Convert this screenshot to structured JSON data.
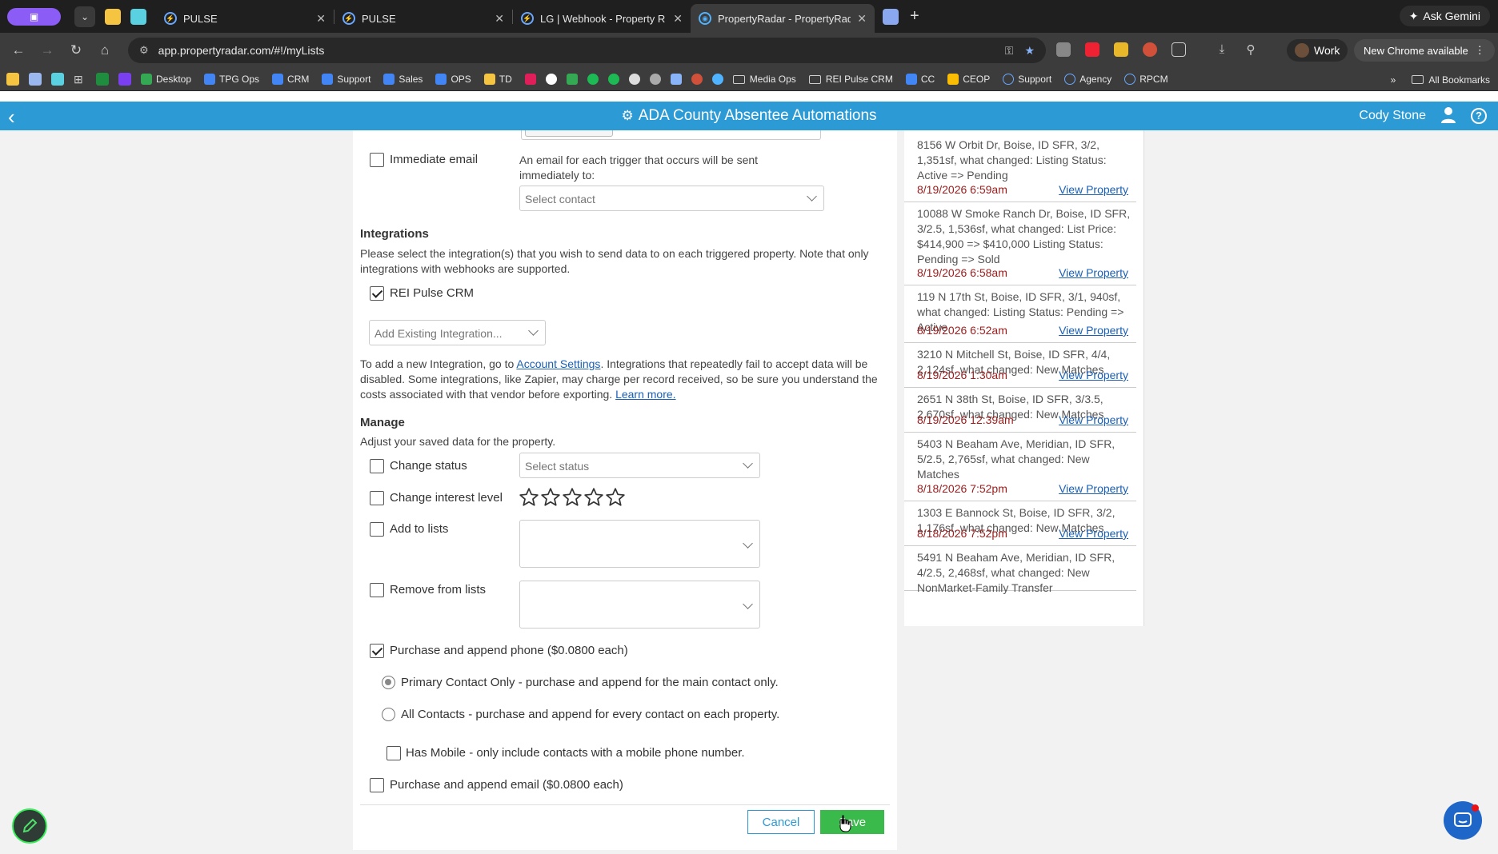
{
  "browser": {
    "tabs": [
      {
        "label": "PULSE"
      },
      {
        "label": "PULSE"
      },
      {
        "label": "LG | Webhook - Property R"
      },
      {
        "label": "PropertyRadar - PropertyRad"
      }
    ],
    "url": "app.propertyradar.com/#!/myLists",
    "profile_label": "Work",
    "update_label": "New Chrome available",
    "gemini_label": "Ask Gemini"
  },
  "bookmarks": {
    "items": [
      "Desktop",
      "TPG Ops",
      "CRM",
      "Support",
      "Sales",
      "OPS",
      "TD",
      "Media Ops",
      "REI Pulse CRM",
      "CC",
      "CEOP",
      "Support",
      "Agency",
      "RPCM"
    ],
    "overflow": "»",
    "all_label": "All Bookmarks"
  },
  "header": {
    "title": "ADA County Absentee Automations",
    "user": "Cody Stone",
    "help": "?"
  },
  "form": {
    "immediate_email_label": "Immediate email",
    "immediate_email_desc": "An email for each trigger that occurs will be sent immediately to:",
    "select_contact_placeholder": "Select contact",
    "integrations_heading": "Integrations",
    "integrations_desc": "Please select the integration(s) that you wish to send data to on each triggered property. Note that only integrations with webhooks are supported.",
    "rei_pulse_label": "REI Pulse CRM",
    "add_integration_placeholder": "Add Existing Integration...",
    "new_integration_prefix": "To add a new Integration, go to ",
    "account_settings_link": "Account Settings",
    "new_integration_suffix": ". Integrations that repeatedly fail to accept data will be disabled. Some integrations, like Zapier, may charge per record received, so be sure you understand the costs associated with that vendor before exporting. ",
    "learn_more_link": "Learn more.",
    "manage_heading": "Manage",
    "manage_desc": "Adjust your saved data for the property.",
    "change_status_label": "Change status",
    "select_status_placeholder": "Select status",
    "change_interest_label": "Change interest level",
    "interest_rating": 0,
    "interest_max": 5,
    "add_to_lists_label": "Add to lists",
    "remove_from_lists_label": "Remove from lists",
    "purchase_phone_label": "Purchase and append phone ($0.0800 each)",
    "primary_contact_label": "Primary Contact Only - purchase and append for the main contact only.",
    "all_contacts_label": "All Contacts - purchase and append for every contact on each property.",
    "has_mobile_label": "Has Mobile - only include contacts with a mobile phone number.",
    "purchase_email_label": "Purchase and append email ($0.0800 each)",
    "cancel_label": "Cancel",
    "save_label": "Save"
  },
  "feed": [
    {
      "text": "8156 W Orbit Dr, Boise, ID SFR, 3/2, 1,351sf, what changed: Listing Status: Active => Pending",
      "date": "8/19/2026 6:59am",
      "link": "View Property"
    },
    {
      "text": "10088 W Smoke Ranch Dr, Boise, ID SFR, 3/2.5, 1,536sf, what changed: List Price: $414,900 => $410,000 Listing Status: Pending => Sold",
      "date": "8/19/2026 6:58am",
      "link": "View Property"
    },
    {
      "text": "119 N 17th St, Boise, ID SFR, 3/1, 940sf, what changed: Listing Status: Pending => Active",
      "date": "8/19/2026 6:52am",
      "link": "View Property"
    },
    {
      "text": "3210 N Mitchell St, Boise, ID SFR, 4/4, 2,124sf, what changed: New Matches",
      "date": "8/19/2026 1:30am",
      "link": "View Property"
    },
    {
      "text": "2651 N 38th St, Boise, ID SFR, 3/3.5, 2,670sf, what changed: New Matches",
      "date": "8/19/2026 12:39am",
      "link": "View Property"
    },
    {
      "text": "5403 N Beaham Ave, Meridian, ID SFR, 5/2.5, 2,765sf, what changed: New Matches",
      "date": "8/18/2026 7:52pm",
      "link": "View Property"
    },
    {
      "text": "1303 E Bannock St, Boise, ID SFR, 3/2, 1,176sf, what changed: New Matches",
      "date": "8/18/2026 7:52pm",
      "link": "View Property"
    },
    {
      "text": "5491 N Beaham Ave, Meridian, ID SFR, 4/2.5, 2,468sf, what changed: New NonMarket-Family Transfer",
      "date": "",
      "link": ""
    }
  ]
}
